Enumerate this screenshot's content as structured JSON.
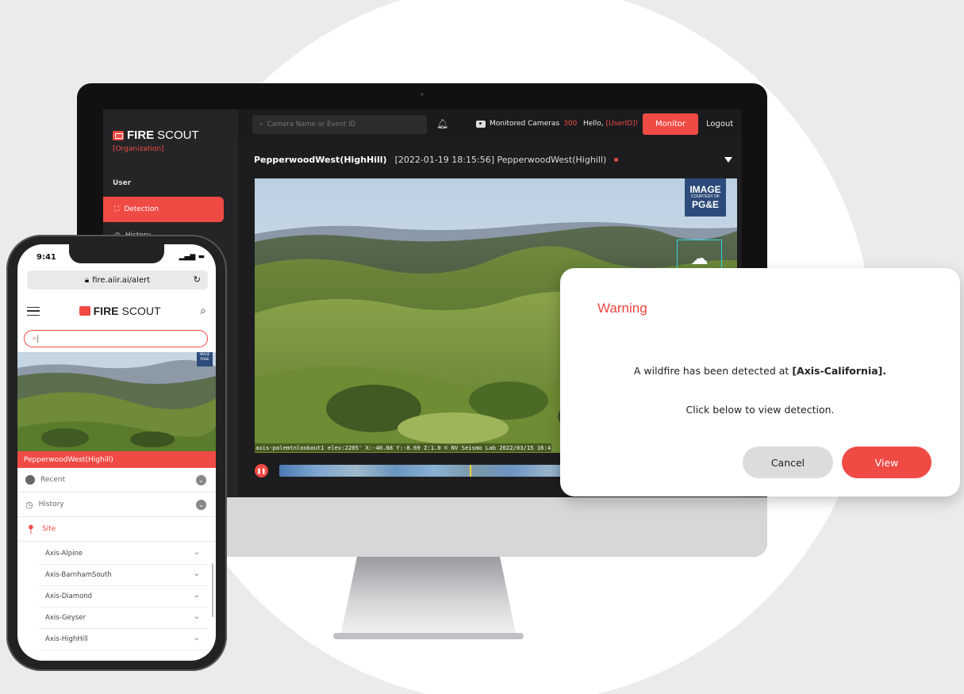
{
  "desktop": {
    "brand_bold": "FIRE",
    "brand_rest": "SCOUT",
    "organization": "[Organization]",
    "sidebar_section": "User",
    "sidebar_items": [
      {
        "label": "Detection",
        "icon": "detection-icon"
      },
      {
        "label": "History",
        "icon": "history-icon"
      }
    ],
    "search_placeholder": "Camera Name or Event ID",
    "monitored_label": "Monitored Cameras",
    "monitored_count": "300",
    "hello_prefix": "Hello,",
    "user_id": "[UserID]!",
    "monitor_button": "Monitor",
    "logout": "Logout",
    "camera_name": "PepperwoodWest(HighHill)",
    "event_info": "[2022-01-19 18:15:56] PepperwoodWest(Highill)",
    "image_credit": {
      "line1": "IMAGE",
      "line2": "COURTESY OF",
      "line3": "PG&E"
    },
    "overlay_text": "axis-polemtnlookout1 elev:2205' X:-40.88 Y:-8.69 Z:1.0  © NV Seismo Lab 2022/03/15 16:4",
    "accent": "#f04a45"
  },
  "dialog": {
    "title": "Warning",
    "message_prefix": "A wildfire has been detected at",
    "message_location": "[Axis-California].",
    "subtext": "Click below to view detection.",
    "cancel": "Cancel",
    "view": "View"
  },
  "phone": {
    "time": "9:41",
    "url": "fire.aiir.ai/alert",
    "brand_bold": "FIRE",
    "brand_rest": "SCOUT",
    "search_value": "",
    "image_credit": "IMAGE PG&E",
    "camera_bar": "PepperwoodWest(Highill)",
    "sections": [
      {
        "label": "Recent"
      },
      {
        "label": "History"
      },
      {
        "label": "Site"
      }
    ],
    "sites": [
      "Axis-Alpine",
      "Axis-BarnhamSouth",
      "Axis-Diamond",
      "Axis-Geyser",
      "Axis-HighHill"
    ]
  }
}
